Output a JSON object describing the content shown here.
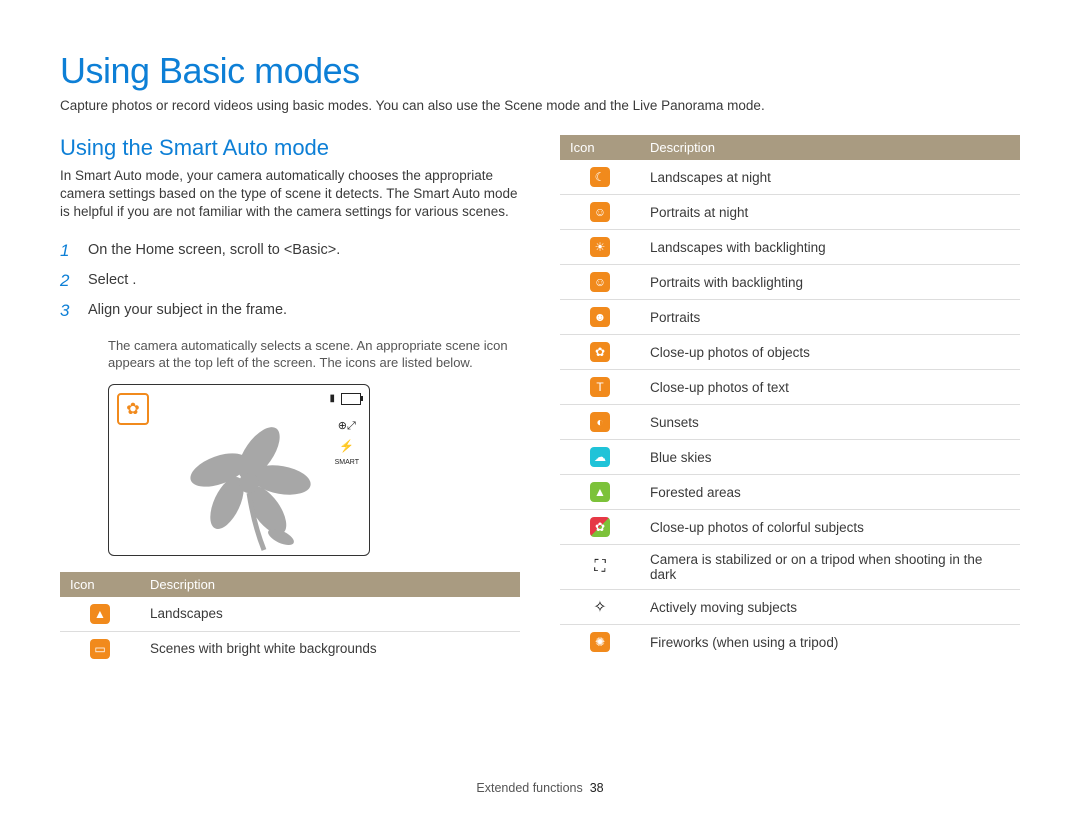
{
  "page_title": "Using Basic modes",
  "intro": "Capture photos or record videos using basic modes. You can also use the Scene mode and the Live Panorama mode.",
  "section_title": "Using the Smart Auto mode",
  "section_para": "In Smart Auto mode, your camera automatically chooses the appropriate camera settings based on the type of scene it detects. The Smart Auto mode is helpful if you are not familiar with the camera settings for various scenes.",
  "steps": [
    {
      "num": "1",
      "text": "On the Home screen, scroll to <Basic>."
    },
    {
      "num": "2",
      "text": "Select      ."
    },
    {
      "num": "3",
      "text": "Align your subject in the frame."
    }
  ],
  "step3_sub": "The camera automatically selects a scene. An appropriate scene icon appears at the top left of the screen. The icons are listed below.",
  "table_headers": {
    "icon": "Icon",
    "desc": "Description"
  },
  "left_rows": [
    {
      "glyph": "▲",
      "cls": "orange",
      "desc": "Landscapes"
    },
    {
      "glyph": "▭",
      "cls": "orange",
      "desc": "Scenes with bright white backgrounds"
    }
  ],
  "right_rows": [
    {
      "glyph": "☾",
      "cls": "orange",
      "desc": "Landscapes at night"
    },
    {
      "glyph": "☺",
      "cls": "orange",
      "desc": "Portraits at night"
    },
    {
      "glyph": "☀",
      "cls": "orange",
      "desc": "Landscapes with backlighting"
    },
    {
      "glyph": "☺",
      "cls": "orange",
      "desc": "Portraits with backlighting"
    },
    {
      "glyph": "☻",
      "cls": "orange",
      "desc": "Portraits"
    },
    {
      "glyph": "✿",
      "cls": "orange",
      "desc": "Close-up photos of objects"
    },
    {
      "glyph": "T",
      "cls": "orange",
      "desc": "Close-up photos of text"
    },
    {
      "glyph": "◐",
      "cls": "orange",
      "desc": "Sunsets"
    },
    {
      "glyph": "☁",
      "cls": "cyan",
      "desc": "Blue skies"
    },
    {
      "glyph": "▲",
      "cls": "lime",
      "desc": "Forested areas"
    },
    {
      "glyph": "✿",
      "cls": "multi",
      "desc": "Close-up photos of colorful subjects"
    },
    {
      "glyph": "⛶",
      "cls": "black",
      "desc": "Camera is stabilized or on a tripod when shooting in the dark"
    },
    {
      "glyph": "✧",
      "cls": "black",
      "desc": "Actively moving subjects"
    },
    {
      "glyph": "✺",
      "cls": "orange",
      "desc": "Fireworks (when using a tripod)"
    }
  ],
  "footer": {
    "section": "Extended functions",
    "page": "38"
  }
}
